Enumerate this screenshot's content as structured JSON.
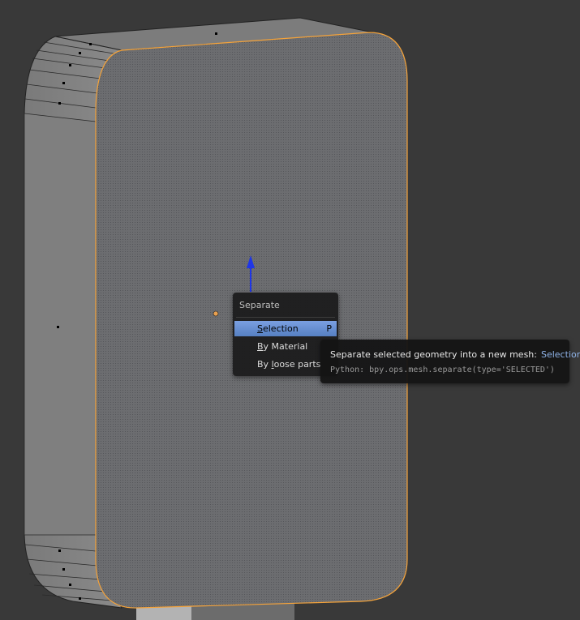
{
  "menu": {
    "title": "Separate",
    "items": [
      {
        "label_pre": "",
        "label_ul": "S",
        "label_post": "election",
        "shortcut": "P",
        "active": true
      },
      {
        "label_pre": "",
        "label_ul": "B",
        "label_post": "y Material",
        "shortcut": "",
        "active": false
      },
      {
        "label_pre": "By ",
        "label_ul": "l",
        "label_post": "oose parts",
        "shortcut": "",
        "active": false
      }
    ]
  },
  "tooltip": {
    "description": "Separate selected geometry into a new mesh:",
    "highlight": "Selection",
    "python": "Python: bpy.ops.mesh.separate(type='SELECTED')"
  },
  "colors": {
    "viewport_bg": "#393939",
    "selection_outline": "#f5a33a",
    "menu_active": "#5680c2",
    "gizmo_z": "#1f36e8"
  }
}
